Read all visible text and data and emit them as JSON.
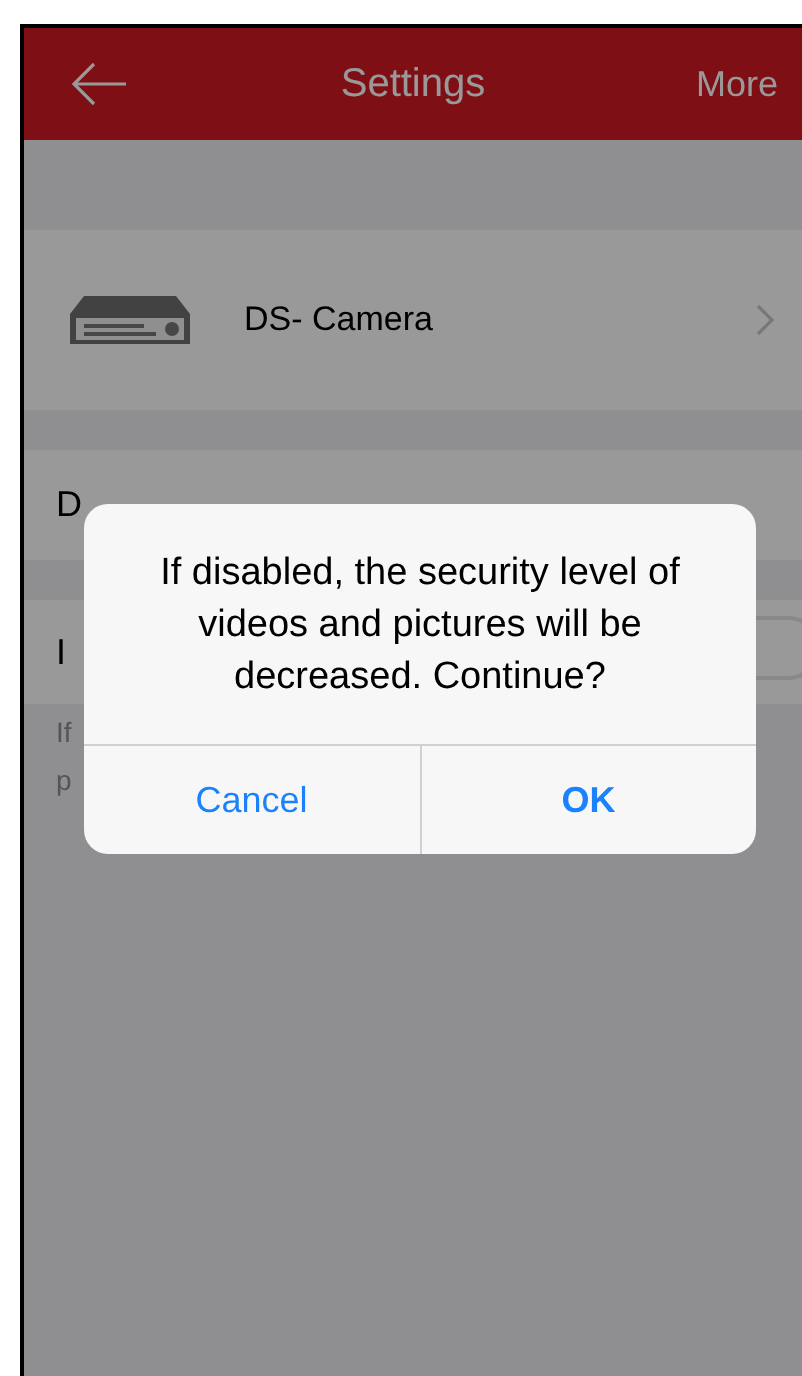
{
  "nav": {
    "title": "Settings",
    "action": "More"
  },
  "device": {
    "name": "DS- Camera"
  },
  "rows": [
    {
      "kind": "text",
      "label": "D"
    },
    {
      "kind": "switch",
      "label": "I",
      "on": false
    }
  ],
  "note": {
    "lines": [
      "If",
      "p"
    ]
  },
  "dialog": {
    "message": "If disabled, the security level of videos and pictures will be decreased. Continue?",
    "buttons": [
      {
        "label": "Cancel",
        "primary": false
      },
      {
        "label": "OK",
        "primary": true
      }
    ]
  }
}
